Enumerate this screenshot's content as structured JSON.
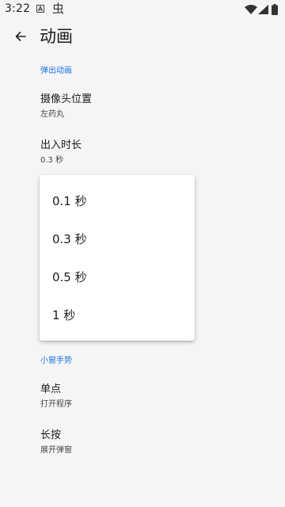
{
  "status_bar": {
    "time": "3:22",
    "icons": [
      "a-notification-icon",
      "bug-icon",
      "wifi-icon",
      "cell-signal-icon",
      "battery-icon"
    ]
  },
  "app_bar": {
    "title": "动画",
    "back_icon": "back-arrow-icon"
  },
  "sections": [
    {
      "header": "弹出动画",
      "items": [
        {
          "title": "摄像头位置",
          "summary": "左药丸"
        },
        {
          "title": "出入时长",
          "summary": "0.3 秒"
        }
      ]
    },
    {
      "header": "小窗手势",
      "items": [
        {
          "title": "单点",
          "summary": "打开程序"
        },
        {
          "title": "长按",
          "summary": "展开弹窗"
        }
      ]
    }
  ],
  "duration_menu": {
    "options": [
      "0.1 秒",
      "0.3 秒",
      "0.5 秒",
      "1 秒"
    ]
  },
  "colors": {
    "accent": "#1a73e8",
    "background": "#f5f5f5",
    "menu_background": "#ffffff"
  }
}
